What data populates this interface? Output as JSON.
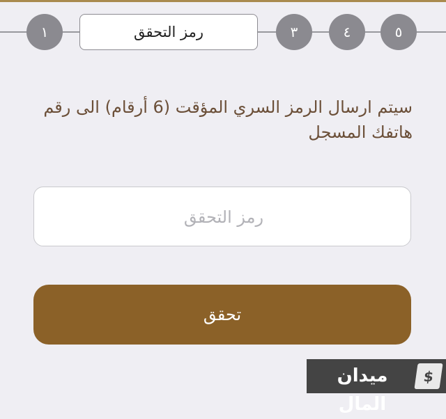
{
  "stepper": {
    "steps": [
      {
        "label": "٥"
      },
      {
        "label": "٤"
      },
      {
        "label": "٣"
      },
      {
        "label": "رمز التحقق"
      },
      {
        "label": "١"
      }
    ]
  },
  "instruction": "سيتم ارسال الرمز السري المؤقت (6 أرقام) الى رقم هاتفك المسجل",
  "code_input": {
    "placeholder": "رمز التحقق",
    "value": ""
  },
  "verify_button_label": "تحقق",
  "watermark": {
    "text": "ميدان المال",
    "icon": "dollar-document-icon",
    "icon_glyph": "$"
  },
  "colors": {
    "background": "#efeef3",
    "accent_brown": "#8b6128",
    "instruction_text": "#6b4f38",
    "step_circle": "#8b8a90"
  }
}
